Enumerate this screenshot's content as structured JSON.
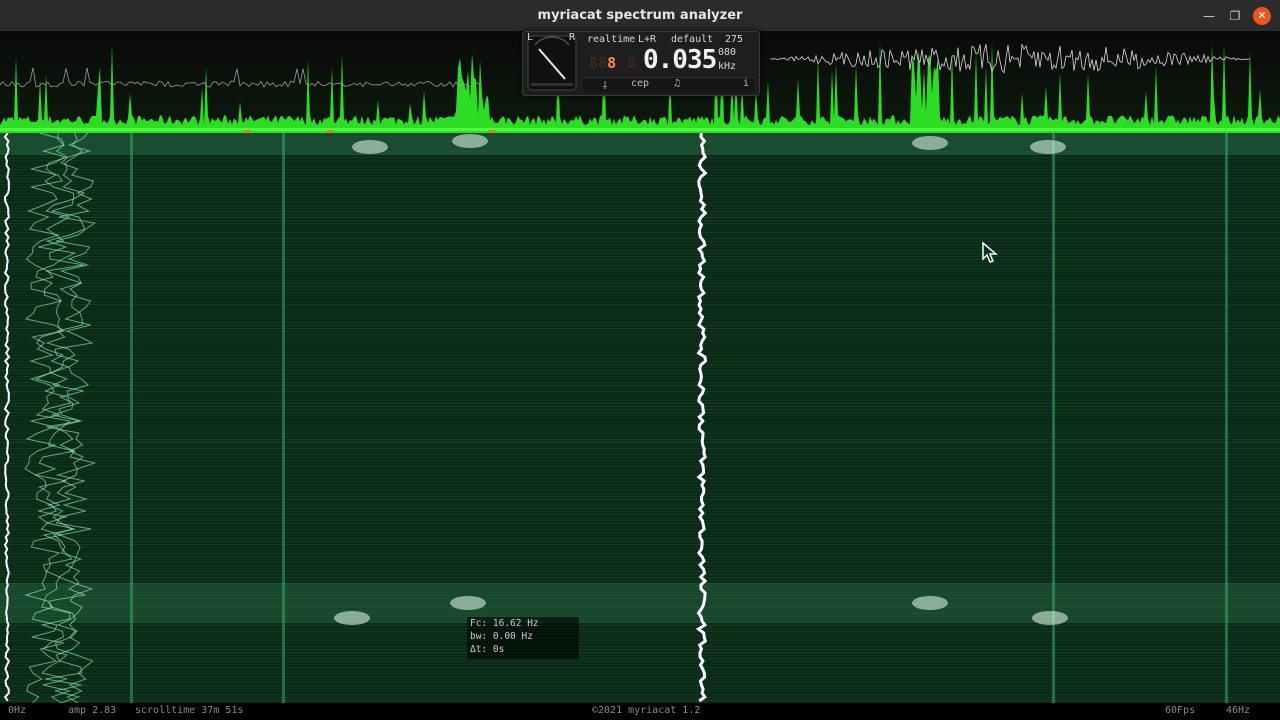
{
  "window": {
    "title": "myriacat spectrum analyzer",
    "minimize_glyph": "—",
    "maximize_glyph": "❐",
    "close_glyph": "✕"
  },
  "hud": {
    "meter_left": "L",
    "meter_right": "R",
    "mode": "realtime",
    "channel": "L+R",
    "preset": "default",
    "fft_value": "275",
    "segment_value": "8",
    "segment_ghost": "88",
    "ghost_digit": "8",
    "frequency": "0.035",
    "frequency_suffix": "080",
    "unit": "kHz",
    "tool_1": "⸸",
    "tool_2": "cep",
    "tool_3": "♫",
    "info": "i"
  },
  "tooltip": {
    "fc": "Fc: 16.62 Hz",
    "bw": "bw: 0.00 Hz",
    "dt": "Δt: 0s"
  },
  "status": {
    "left_freq": "0Hz",
    "amp": "amp 2.83",
    "scrolltime": "scrolltime 37m 51s",
    "copyright": "©2021 myriacat 1.2",
    "fps": "60Fps",
    "right_freq": "46Hz"
  },
  "colors": {
    "spectrum": "#32ff2a",
    "waterfall_bg": "#0b2a17",
    "trace": "#ffffff",
    "accent": "#e95420",
    "marker": "#c98a1c"
  },
  "icons": [
    "minimize-icon",
    "maximize-icon",
    "close-icon",
    "level-meter-icon",
    "cursor-icon",
    "marker-icon"
  ]
}
